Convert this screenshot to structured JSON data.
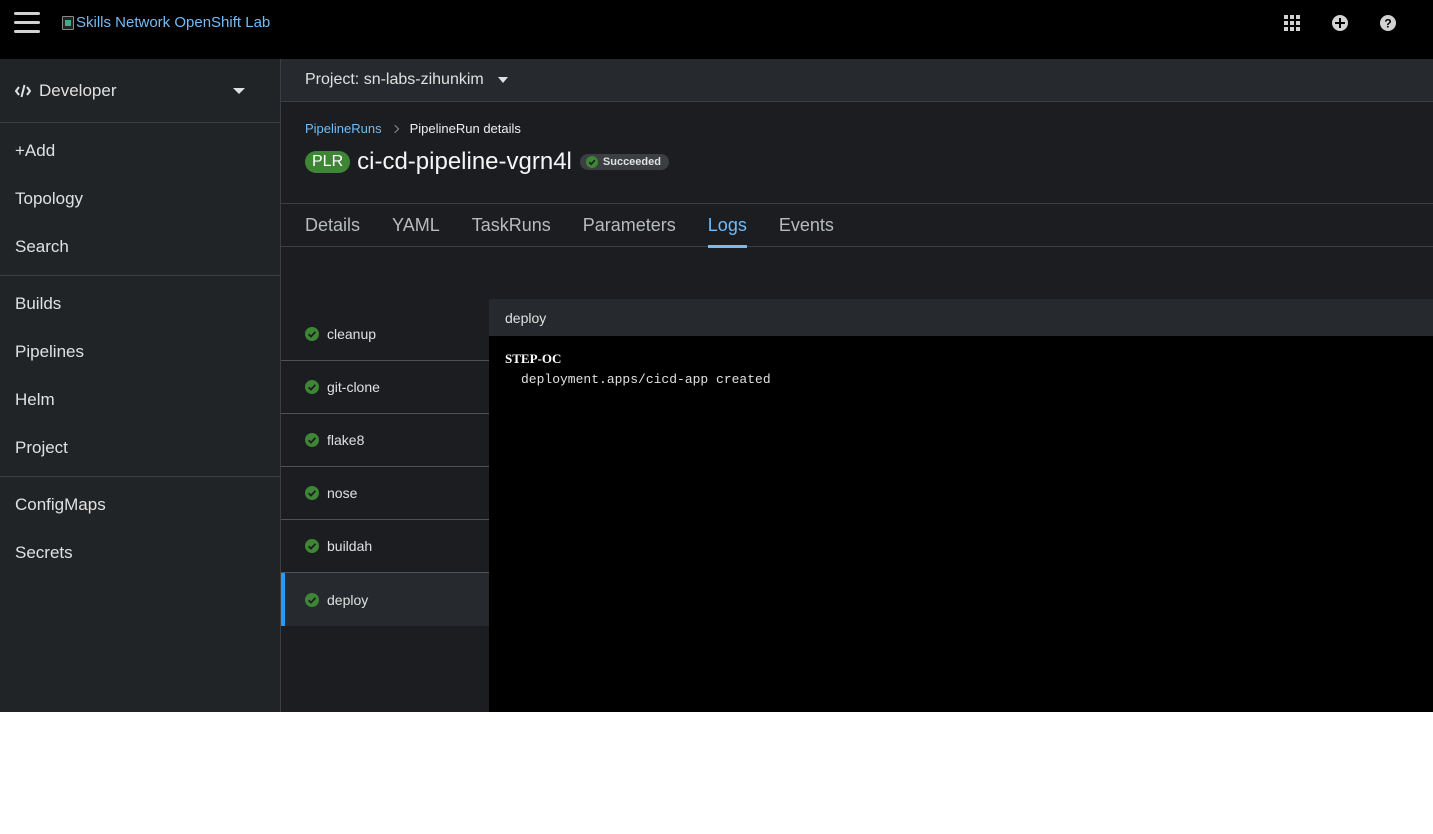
{
  "masthead": {
    "logo_alt": "Skills Network OpenShift Lab",
    "icons": [
      "app-launcher-icon",
      "plus-circle-icon",
      "help-icon"
    ]
  },
  "sidebar": {
    "perspective": "Developer",
    "groups": [
      [
        "+Add",
        "Topology",
        "Search"
      ],
      [
        "Builds",
        "Pipelines",
        "Helm",
        "Project"
      ],
      [
        "ConfigMaps",
        "Secrets"
      ]
    ]
  },
  "project": {
    "label": "Project: sn-labs-zihunkim"
  },
  "breadcrumb": {
    "parent": "PipelineRuns",
    "current": "PipelineRun details"
  },
  "pipelinerun": {
    "kind_badge": "PLR",
    "name": "ci-cd-pipeline-vgrn4l",
    "status": "Succeeded",
    "status_color": "#3e8635"
  },
  "tabs": [
    "Details",
    "YAML",
    "TaskRuns",
    "Parameters",
    "Logs",
    "Events"
  ],
  "active_tab": "Logs",
  "tasks": [
    "cleanup",
    "git-clone",
    "flake8",
    "nose",
    "buildah",
    "deploy"
  ],
  "active_task": "deploy",
  "log": {
    "title": "deploy",
    "step": "STEP-OC",
    "lines": [
      "deployment.apps/cicd-app created"
    ]
  }
}
